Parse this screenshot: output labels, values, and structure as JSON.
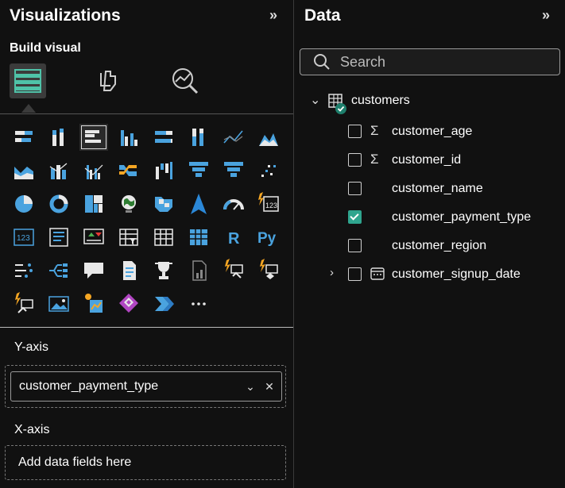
{
  "visualizations": {
    "title": "Visualizations",
    "build_visual": "Build visual",
    "mode_tabs": [
      {
        "icon": "build-visual-icon",
        "active": true
      },
      {
        "icon": "format-visual-icon",
        "active": false
      },
      {
        "icon": "analytics-icon",
        "active": false
      }
    ],
    "visual_types": [
      "stacked-bar-chart-icon",
      "stacked-column-chart-icon",
      "clustered-bar-chart-icon",
      "clustered-column-chart-icon",
      "100-stacked-bar-chart-icon",
      "100-stacked-column-chart-icon",
      "line-chart-icon",
      "area-chart-icon",
      "stacked-area-chart-icon",
      "line-stacked-column-chart-icon",
      "line-clustered-column-chart-icon",
      "ribbon-chart-icon",
      "waterfall-chart-icon",
      "funnel-chart-icon",
      "scatter-chart-icon",
      "pie-chart-icon",
      "donut-chart-icon",
      "treemap-icon",
      "map-icon",
      "filled-map-icon",
      "azure-map-icon",
      "gauge-icon",
      "card-icon",
      "multi-row-card-icon",
      "kpi-icon",
      "slicer-icon",
      "table-icon",
      "matrix-icon",
      "r-visual-icon",
      "python-visual-icon",
      "key-influencers-icon",
      "decomposition-tree-icon",
      "qa-icon",
      "smart-narrative-icon",
      "paginated-report-icon",
      "metrics-icon",
      "power-apps-icon",
      "power-automate-icon",
      "more-visuals-icon",
      "narrative-icon"
    ],
    "y_axis": {
      "label": "Y-axis",
      "field": "customer_payment_type"
    },
    "x_axis": {
      "label": "X-axis",
      "placeholder": "Add data fields here"
    }
  },
  "data": {
    "title": "Data",
    "search_placeholder": "Search",
    "table": {
      "name": "customers"
    },
    "fields": [
      {
        "name": "customer_age",
        "checked": false,
        "type": "sigma"
      },
      {
        "name": "customer_id",
        "checked": false,
        "type": "sigma"
      },
      {
        "name": "customer_name",
        "checked": false,
        "type": "text"
      },
      {
        "name": "customer_payment_type",
        "checked": true,
        "type": "text"
      },
      {
        "name": "customer_region",
        "checked": false,
        "type": "text"
      },
      {
        "name": "customer_signup_date",
        "checked": false,
        "type": "date"
      }
    ]
  },
  "colors": {
    "accent_blue": "#4aa3df",
    "accent_teal": "#2fa58e",
    "warn_orange": "#f5a623",
    "purple": "#b146c2"
  }
}
